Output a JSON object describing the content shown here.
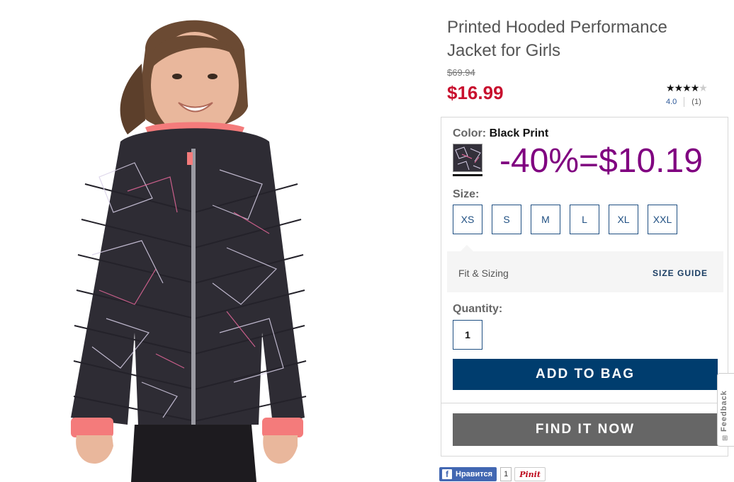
{
  "product": {
    "title": "Printed Hooded Performance Jacket for Girls",
    "old_price": "$69.94",
    "price": "$16.99"
  },
  "rating": {
    "stars": 4,
    "max_stars": 5,
    "value": "4.0",
    "count": "(1)"
  },
  "color": {
    "label": "Color:",
    "value": "Black Print"
  },
  "promo_text": "-40%=$10.19",
  "size": {
    "label": "Size:",
    "options": [
      "XS",
      "S",
      "M",
      "L",
      "XL",
      "XXL"
    ]
  },
  "fit": {
    "label": "Fit & Sizing",
    "guide_label": "SIZE GUIDE"
  },
  "quantity": {
    "label": "Quantity:",
    "value": "1"
  },
  "buttons": {
    "add_to_bag": "ADD TO BAG",
    "find_it_now": "FIND IT NOW"
  },
  "feedback": {
    "label": "Feedback",
    "icon": "plus-icon"
  },
  "social": {
    "like_label": "Нравится",
    "like_count": "1",
    "pin_label": "Pinit"
  },
  "colors": {
    "price_red": "#c8102e",
    "promo_purple": "#800080",
    "navy_button": "#003d6e",
    "gray_button": "#666666",
    "size_border": "#1f4f82"
  }
}
